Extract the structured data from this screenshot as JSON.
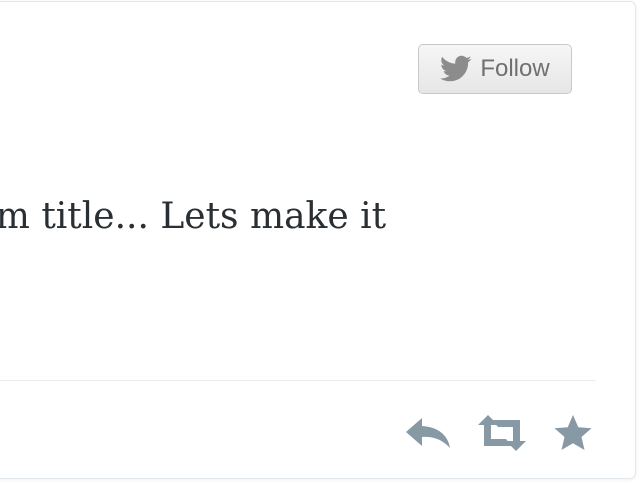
{
  "embedded_tweet": {
    "follow_button": {
      "label": "Follow",
      "icon": "twitter-bird-icon"
    },
    "text": "Album title... Lets make it",
    "actions": [
      {
        "name": "reply",
        "icon": "reply-icon"
      },
      {
        "name": "retweet",
        "icon": "retweet-icon"
      },
      {
        "name": "favorite",
        "icon": "star-icon"
      }
    ],
    "colors": {
      "icon_gray": "#8899a6",
      "text": "#292f33",
      "button_text": "#707070"
    }
  }
}
